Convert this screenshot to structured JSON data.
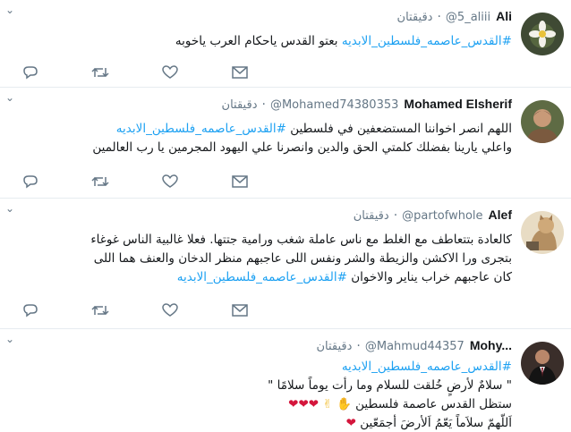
{
  "tweets": [
    {
      "name": "Ali",
      "handle": "@5_aliii",
      "time": "دقيقتان",
      "tag": "#القدس_عاصمه_فلسطين_الابديه",
      "text": "بعتو القدس ياحكام العرب ياخوبه",
      "avatar": "flower-photo"
    },
    {
      "name": "Mohamed Elsherif",
      "handle": "@Mohamed74380353",
      "time": "دقيقتان",
      "tag": "#القدس_عاصمه_فلسطين_الابديه",
      "line1": "اللهم انصر اخواننا المستضعفين في فلسطين",
      "line2": "واعلي يارينا بفضلك كلمتي الحق والدين وانصرنا علي اليهود المجرمين يا رب العالمين",
      "avatar": "man-photo"
    },
    {
      "name": "Alef",
      "handle": "@partofwhole",
      "time": "دقيقتان",
      "line1": "كالعادة بتتعاطف مع الغلط مع ناس عاملة شغب ورامية جتتها. فعلا غالبية الناس غوغاء",
      "line2": "بتجرى ورا الاكشن والزيطة والشر ونفس اللى عاجبهم منظر الدخان والعنف هما اللى",
      "line3": "كان عاجبهم خراب يناير والاخوان",
      "tag": "#القدس_عاصمه_فلسطين_الابديه",
      "avatar": "cat-illustration"
    },
    {
      "name": "Mohy...",
      "handle": "@Mahmud44357",
      "time": "دقيقتان",
      "tag": "#القدس_عاصمه_فلسطين_الابديه",
      "line1": "\" سلامٌ لأرضٍ خُلقت للسلام وما رأت يوماً سلامًا \"",
      "line2": "ستظل القدس عاصمة فلسطين",
      "line3": "اَللّهمّ سلاَماً يَعّمُ اَلأرضَ أجمَعّين",
      "avatar": "man-suit-photo"
    }
  ],
  "icons": {
    "reply": "reply-icon",
    "retweet": "retweet-icon",
    "like": "heart-icon",
    "message": "envelope-icon",
    "caret": "chevron-down-icon"
  },
  "colors": {
    "link": "#1da1f2",
    "meta": "#657786",
    "divider": "#e6ecf0",
    "heart": "#d4163c"
  }
}
